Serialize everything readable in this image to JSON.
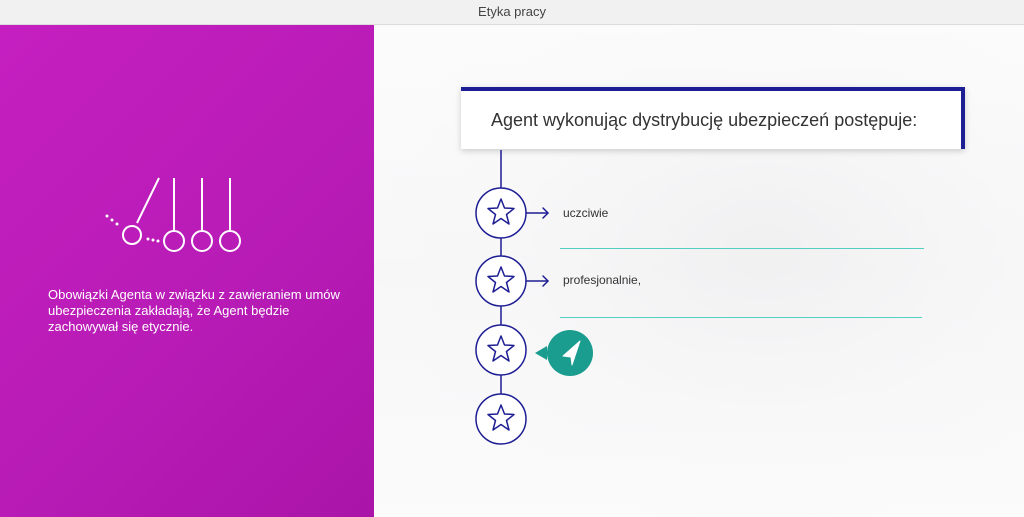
{
  "window": {
    "title": "Etyka pracy"
  },
  "left_panel": {
    "icon": "newtons-cradle-icon",
    "description": "Obowiązki Agenta w związku z zawieraniem umów ubezpieczenia zakładają, że Agent będzie zachowywał się etycznie."
  },
  "main": {
    "heading": "Agent wykonując dystrybucję ubezpieczeń postępuje:",
    "items": [
      {
        "icon": "star-icon",
        "label": "uczciwie"
      },
      {
        "icon": "star-icon",
        "label": "profesjonalnie,"
      },
      {
        "icon": "star-icon",
        "label": ""
      },
      {
        "icon": "star-icon",
        "label": ""
      }
    ],
    "next_button_icon": "cursor-arrow-icon"
  },
  "colors": {
    "left_panel": "#c51fc0",
    "timeline": "#1e1e94",
    "accent": "#1a9c8e",
    "underline": "#53cfc2"
  }
}
